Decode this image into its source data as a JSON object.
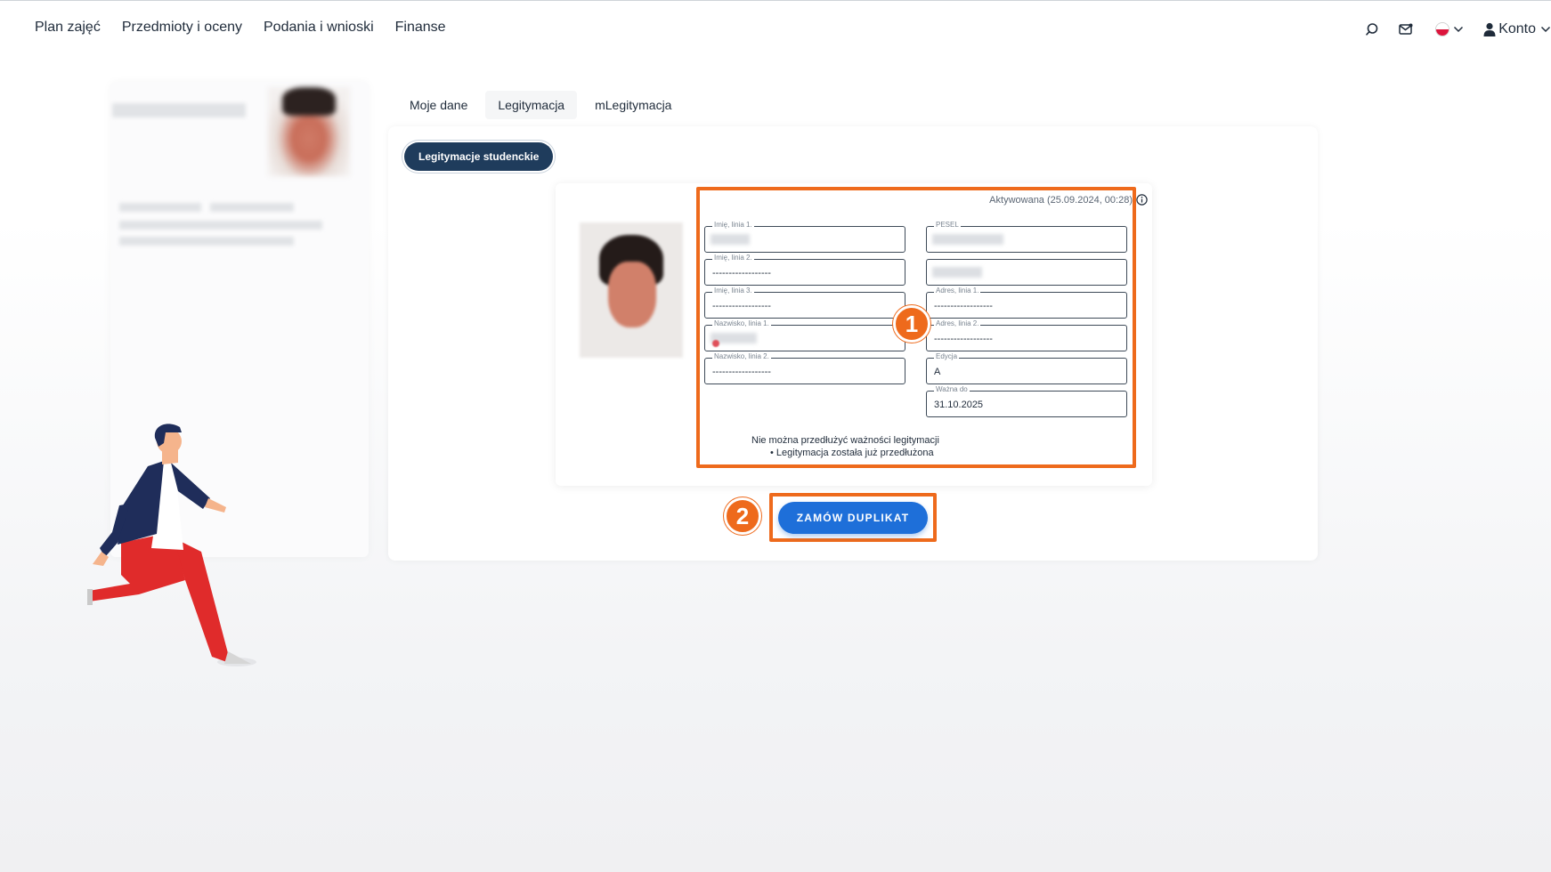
{
  "nav": {
    "links": [
      {
        "label": "Plan zajęć"
      },
      {
        "label": "Przedmioty i oceny"
      },
      {
        "label": "Podania i wnioski"
      },
      {
        "label": "Finanse"
      }
    ],
    "account_label": "Konto",
    "icons": [
      "search-icon",
      "mail-icon",
      "poland-flag-icon",
      "chevron-down-icon",
      "user-icon"
    ]
  },
  "tabs": [
    {
      "label": "Moje dane",
      "active": false
    },
    {
      "label": "Legitymacja",
      "active": true
    },
    {
      "label": "mLegitymacja",
      "active": false
    }
  ],
  "section_pill": "Legitymacje studenckie",
  "card": {
    "activated": "Aktywowana (25.09.2024, 00:28)",
    "left_fields": [
      {
        "label": "Imię, linia 1.",
        "value": "",
        "redacted": true
      },
      {
        "label": "Imię, linia 2.",
        "value": "------------------"
      },
      {
        "label": "Imię, linia 3.",
        "value": "------------------"
      },
      {
        "label": "Nazwisko, linia 1.",
        "value": "",
        "redacted": true
      },
      {
        "label": "Nazwisko, linia 2.",
        "value": "------------------"
      }
    ],
    "right_fields": [
      {
        "label": "PESEL",
        "value": "",
        "redacted": true
      },
      {
        "label": "",
        "value": "",
        "redacted": true
      },
      {
        "label": "Adres, linia 1.",
        "value": "------------------"
      },
      {
        "label": "Adres, linia 2.",
        "value": "------------------"
      },
      {
        "label": "Edycja",
        "value": "A"
      },
      {
        "label": "Ważna do",
        "value": "31.10.2025"
      }
    ],
    "notice_title": "Nie można przedłużyć ważności legitymacji",
    "notice_bullet": "• Legitymacja została już przedłużona"
  },
  "order_button": "ZAMÓW DUPLIKAT",
  "badges": [
    "1",
    "2"
  ],
  "colors": {
    "accent_orange": "#ee6a1c",
    "button_blue": "#1e6fd9",
    "pill_navy": "#1f3c5c"
  }
}
